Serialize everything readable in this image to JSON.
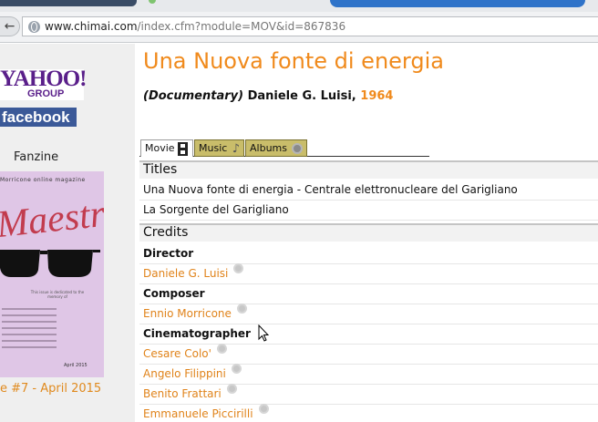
{
  "browser": {
    "url_host": "www.chimai.com",
    "url_path": "/index.cfm?module=MOV&id=867836"
  },
  "sidebar": {
    "yahoo_text": "YAHOO!",
    "yahoo_group": "GROUP",
    "facebook_text": "facebook",
    "fanzine_label": "Fanzine",
    "magazine": {
      "header": "Morricone online magazine",
      "title": "Maestro",
      "dedication": "This issue is dedicated to the memory of",
      "date": "April 2015"
    },
    "issue_label": "e #7 - April 2015"
  },
  "main": {
    "title": "Una Nuova fonte di energia",
    "subtitle_type": "(Documentary)",
    "subtitle_director": " Daniele G. Luisi, ",
    "subtitle_year": "1964",
    "tabs": [
      {
        "label": "Movie"
      },
      {
        "label": "Music"
      },
      {
        "label": "Albums"
      }
    ],
    "titles_heading": "Titles",
    "titles": [
      "Una Nuova fonte di energia - Centrale elettronucleare del Garigliano",
      "La Sorgente del Garigliano"
    ],
    "credits_heading": "Credits",
    "credits": [
      {
        "role": "Director",
        "people": [
          "Daniele G. Luisi"
        ]
      },
      {
        "role": "Composer",
        "people": [
          "Ennio Morricone"
        ]
      },
      {
        "role": "Cinematographer",
        "people": [
          "Cesare Colo'",
          "Angelo Filippini",
          "Benito Frattari",
          "Emmanuele Piccirilli"
        ]
      }
    ]
  },
  "colors": {
    "accent_orange": "#f08a1c",
    "tab_gold": "#c9bd6a",
    "facebook_blue": "#3b5998",
    "yahoo_purple": "#5a1f8a"
  }
}
